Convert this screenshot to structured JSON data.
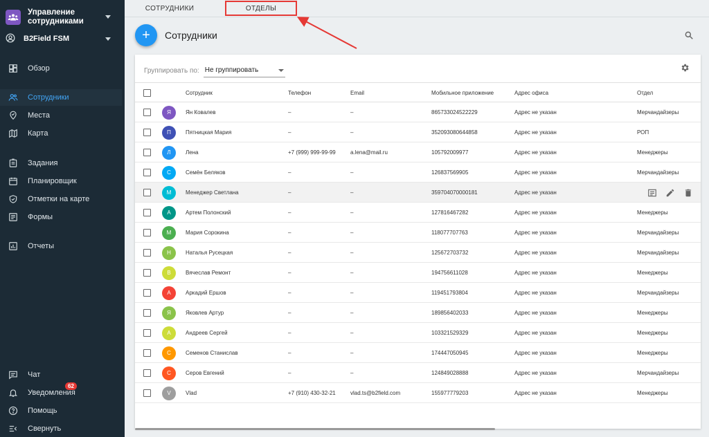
{
  "sidebar": {
    "app_title": "Управление сотрудниками",
    "company": "B2Field FSM",
    "items": [
      {
        "label": "Обзор",
        "icon": "dashboard-icon"
      },
      {
        "label": "Сотрудники",
        "icon": "people-icon",
        "active": true
      },
      {
        "label": "Места",
        "icon": "place-icon"
      },
      {
        "label": "Карта",
        "icon": "map-icon"
      },
      {
        "label": "Задания",
        "icon": "tasks-icon"
      },
      {
        "label": "Планировщик",
        "icon": "calendar-icon"
      },
      {
        "label": "Отметки на карте",
        "icon": "shield-check-icon"
      },
      {
        "label": "Формы",
        "icon": "forms-icon"
      },
      {
        "label": "Отчеты",
        "icon": "reports-icon"
      },
      {
        "label": "Чат",
        "icon": "chat-icon"
      },
      {
        "label": "Уведомления",
        "icon": "bell-icon",
        "badge": "62"
      },
      {
        "label": "Помощь",
        "icon": "help-icon"
      },
      {
        "label": "Свернуть",
        "icon": "collapse-icon"
      }
    ]
  },
  "tabs": [
    {
      "label": "СОТРУДНИКИ"
    },
    {
      "label": "ОТДЕЛЫ"
    }
  ],
  "header": {
    "title": "Сотрудники",
    "add_label": "+"
  },
  "groupby": {
    "label": "Группировать по:",
    "value": "Не группировать"
  },
  "columns": {
    "name": "Сотрудник",
    "phone": "Телефон",
    "email": "Email",
    "app": "Мобильное приложение",
    "addr": "Адрес офиса",
    "dept": "Отдел"
  },
  "rows": [
    {
      "initial": "Я",
      "color": "#7e57c2",
      "name": "Ян Ковалев",
      "phone": "–",
      "email": "–",
      "app": "865733024522229",
      "addr": "Адрес не указан",
      "dept": "Мерчандайзеры"
    },
    {
      "initial": "П",
      "color": "#3f51b5",
      "name": "Пятницкая Мария",
      "phone": "–",
      "email": "–",
      "app": "352093080644858",
      "addr": "Адрес не указан",
      "dept": "РОП"
    },
    {
      "initial": "Л",
      "color": "#2196f3",
      "name": "Лена",
      "phone": "+7 (999) 999-99-99",
      "email": "a.lena@mail.ru",
      "app": "105792009977",
      "addr": "Адрес не указан",
      "dept": "Менеджеры"
    },
    {
      "initial": "С",
      "color": "#03a9f4",
      "name": "Семён Беляков",
      "phone": "–",
      "email": "–",
      "app": "126837569905",
      "addr": "Адрес не указан",
      "dept": "Мерчандайзеры"
    },
    {
      "initial": "М",
      "color": "#00bcd4",
      "name": "Менеджер Светлана",
      "phone": "–",
      "email": "–",
      "app": "359704070000181",
      "addr": "Адрес не указан",
      "dept": "",
      "hover": true
    },
    {
      "initial": "А",
      "color": "#009688",
      "name": "Артем Полонский",
      "phone": "–",
      "email": "–",
      "app": "127816467282",
      "addr": "Адрес не указан",
      "dept": "Менеджеры"
    },
    {
      "initial": "М",
      "color": "#4caf50",
      "name": "Мария Сорокина",
      "phone": "–",
      "email": "–",
      "app": "118077707763",
      "addr": "Адрес не указан",
      "dept": "Мерчандайзеры"
    },
    {
      "initial": "Н",
      "color": "#8bc34a",
      "name": "Наталья Русецкая",
      "phone": "–",
      "email": "–",
      "app": "125672703732",
      "addr": "Адрес не указан",
      "dept": "Мерчандайзеры"
    },
    {
      "initial": "В",
      "color": "#cddc39",
      "name": "Вячеслав Ремонт",
      "phone": "–",
      "email": "–",
      "app": "194756611028",
      "addr": "Адрес не указан",
      "dept": "Менеджеры"
    },
    {
      "initial": "А",
      "color": "#f44336",
      "name": "Аркадий Ершов",
      "phone": "–",
      "email": "–",
      "app": "119451793804",
      "addr": "Адрес не указан",
      "dept": "Мерчандайзеры"
    },
    {
      "initial": "Я",
      "color": "#8bc34a",
      "name": "Яковлев Артур",
      "phone": "–",
      "email": "–",
      "app": "189856402033",
      "addr": "Адрес не указан",
      "dept": "Менеджеры"
    },
    {
      "initial": "А",
      "color": "#cddc39",
      "name": "Андреев Сергей",
      "phone": "–",
      "email": "–",
      "app": "103321529329",
      "addr": "Адрес не указан",
      "dept": "Менеджеры"
    },
    {
      "initial": "С",
      "color": "#ff9800",
      "name": "Семенов Станислав",
      "phone": "–",
      "email": "–",
      "app": "174447050945",
      "addr": "Адрес не указан",
      "dept": "Менеджеры"
    },
    {
      "initial": "С",
      "color": "#ff5722",
      "name": "Серов Евгений",
      "phone": "–",
      "email": "–",
      "app": "124849028888",
      "addr": "Адрес не указан",
      "dept": "Мерчандайзеры"
    },
    {
      "initial": "V",
      "color": "#9e9e9e",
      "name": "Vlad",
      "phone": "+7 (910) 430-32-21",
      "email": "vlad.ts@b2field.com",
      "app": "155977779203",
      "addr": "Адрес не указан",
      "dept": "Менеджеры"
    }
  ]
}
